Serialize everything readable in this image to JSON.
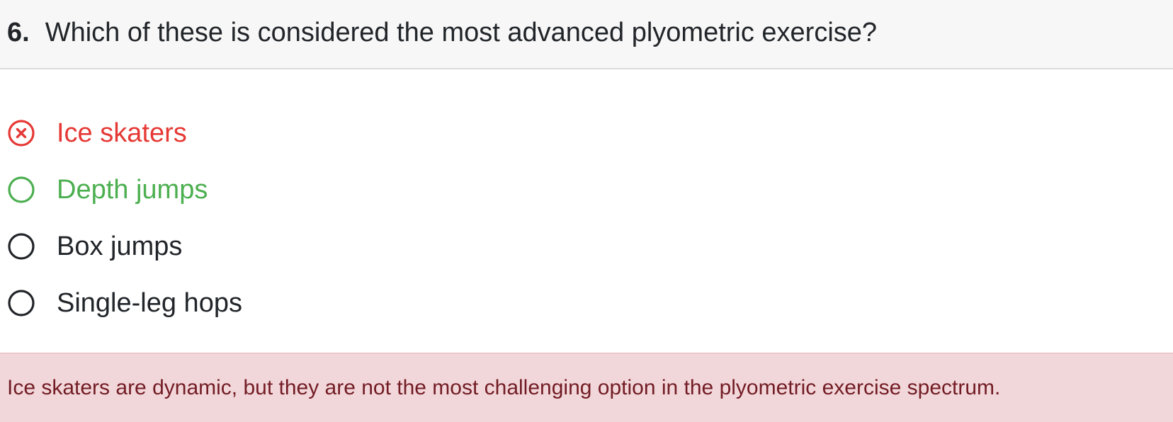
{
  "question": {
    "number": "6.",
    "text": "Which of these is considered the most advanced plyometric exercise?"
  },
  "options": [
    {
      "label": "Ice skaters",
      "state": "selected-incorrect",
      "icon": "x-circle-icon"
    },
    {
      "label": "Depth jumps",
      "state": "correct",
      "icon": "radio-empty-icon"
    },
    {
      "label": "Box jumps",
      "state": "neutral",
      "icon": "radio-empty-icon"
    },
    {
      "label": "Single-leg hops",
      "state": "neutral",
      "icon": "radio-empty-icon"
    }
  ],
  "feedback": {
    "text": "Ice skaters are dynamic, but they are not the most challenging option in the plyometric exercise spectrum."
  },
  "colors": {
    "incorrect": "#e53935",
    "correct": "#4caf50",
    "neutral": "#212529",
    "feedback_bg": "#f2d7da",
    "feedback_text": "#721c24",
    "header_bg": "#f7f7f7"
  }
}
